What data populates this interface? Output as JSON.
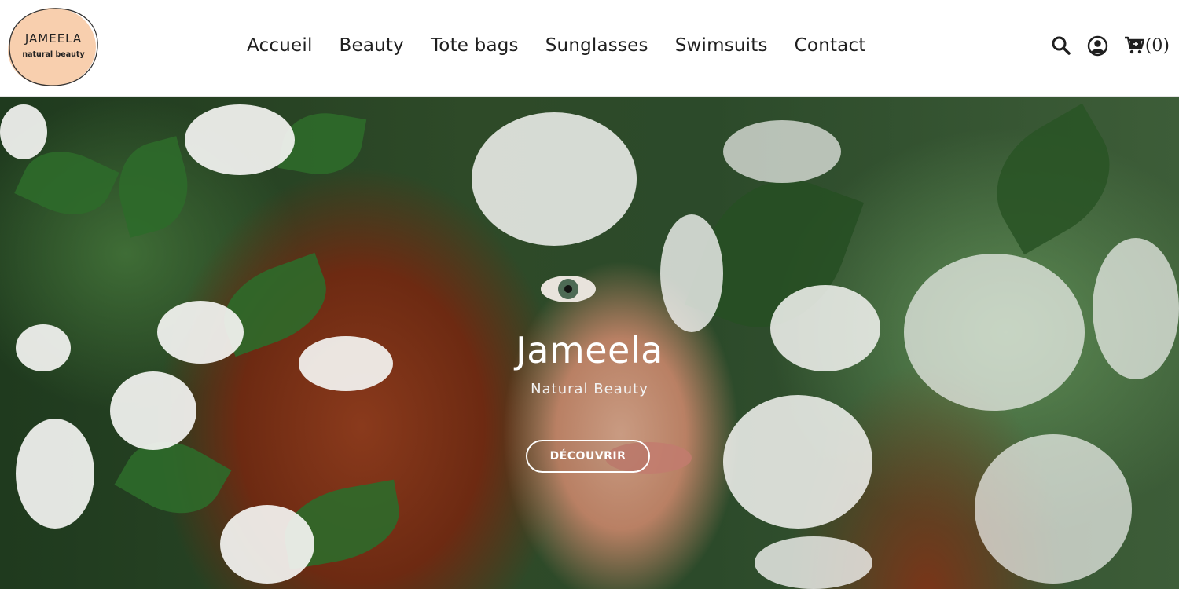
{
  "brand": {
    "name": "JAMEELA",
    "tagline": "natural beauty"
  },
  "nav": {
    "items": [
      {
        "label": "Accueil",
        "name": "nav-item-accueil"
      },
      {
        "label": "Beauty",
        "name": "nav-item-beauty"
      },
      {
        "label": "Tote bags",
        "name": "nav-item-tote-bags"
      },
      {
        "label": "Sunglasses",
        "name": "nav-item-sunglasses"
      },
      {
        "label": "Swimsuits",
        "name": "nav-item-swimsuits"
      },
      {
        "label": "Contact",
        "name": "nav-item-contact"
      }
    ]
  },
  "header_icons": {
    "search": "search-icon",
    "account": "user-icon",
    "cart": "cart-icon",
    "cart_count": "(0)"
  },
  "hero": {
    "title": "Jameela",
    "subtitle": "Natural Beauty",
    "cta_label": "DÉCOUVRIR"
  },
  "colors": {
    "logo_blob": "#f8cfae",
    "text_dark": "#1f1f1f",
    "hero_text": "#ffffff"
  }
}
